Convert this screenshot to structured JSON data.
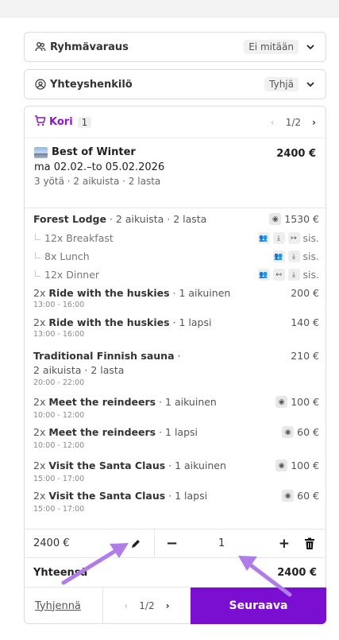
{
  "group_booking": {
    "label": "Ryhmävaraus",
    "value": "Ei mitään"
  },
  "contact": {
    "label": "Yhteyshenkilö",
    "value": "Tyhjä"
  },
  "cart": {
    "label": "Kori",
    "count": "1",
    "pager": {
      "prev": "‹",
      "page": "1/2",
      "next": "›"
    },
    "package": {
      "name": "Best of Winter",
      "price": "2400 €",
      "dates": "ma 02.02.–to 05.02.2026",
      "meta": "3 yötä · 2 aikuista · 2 lasta"
    },
    "items": [
      {
        "name": "Forest Lodge",
        "detail": " · 2 aikuista · 2 lasta",
        "price": "1530 €"
      },
      {
        "name": "12x Breakfast",
        "price": "sis."
      },
      {
        "name": "8x Lunch",
        "price": "sis."
      },
      {
        "name": "12x Dinner",
        "price": "sis."
      },
      {
        "qty": "2x ",
        "name": "Ride with the huskies",
        "detail": " · 1 aikuinen",
        "price": "200 €",
        "time": "13:00 - 16:00"
      },
      {
        "qty": "2x ",
        "name": "Ride with the huskies",
        "detail": " · 1 lapsi",
        "price": "140 €",
        "time": "13:00 - 16:00"
      },
      {
        "name": "Traditional Finnish sauna",
        "detail": " ·",
        "detail2": "2 aikuista · 2 lasta",
        "price": "210 €",
        "time": "20:00 - 22:00"
      },
      {
        "qty": "2x ",
        "name": "Meet the reindeers",
        "detail": " · 1 aikuinen",
        "price": "100 €",
        "time": "10:00 - 12:00"
      },
      {
        "qty": "2x ",
        "name": "Meet the reindeers",
        "detail": " · 1 lapsi",
        "price": "60 €",
        "time": "10:00 - 12:00"
      },
      {
        "qty": "2x ",
        "name": "Visit the Santa Claus",
        "detail": " · 1 aikuinen",
        "price": "100 €",
        "time": "15:00 - 17:00"
      },
      {
        "qty": "2x ",
        "name": "Visit the Santa Claus",
        "detail": " · 1 lapsi",
        "price": "60 €",
        "time": "15:00 - 17:00"
      }
    ],
    "line_total": "2400 €",
    "quantity": "1",
    "total_label": "Yhteensä",
    "total_value": "2400 €"
  },
  "footer": {
    "clear": "Tyhjennä",
    "pager": {
      "prev": "‹",
      "page": "1/2",
      "next": "›"
    },
    "next_button": "Seuraava"
  },
  "colors": {
    "accent": "#7a0fd1",
    "annotation_arrow": "#b07ce8"
  }
}
